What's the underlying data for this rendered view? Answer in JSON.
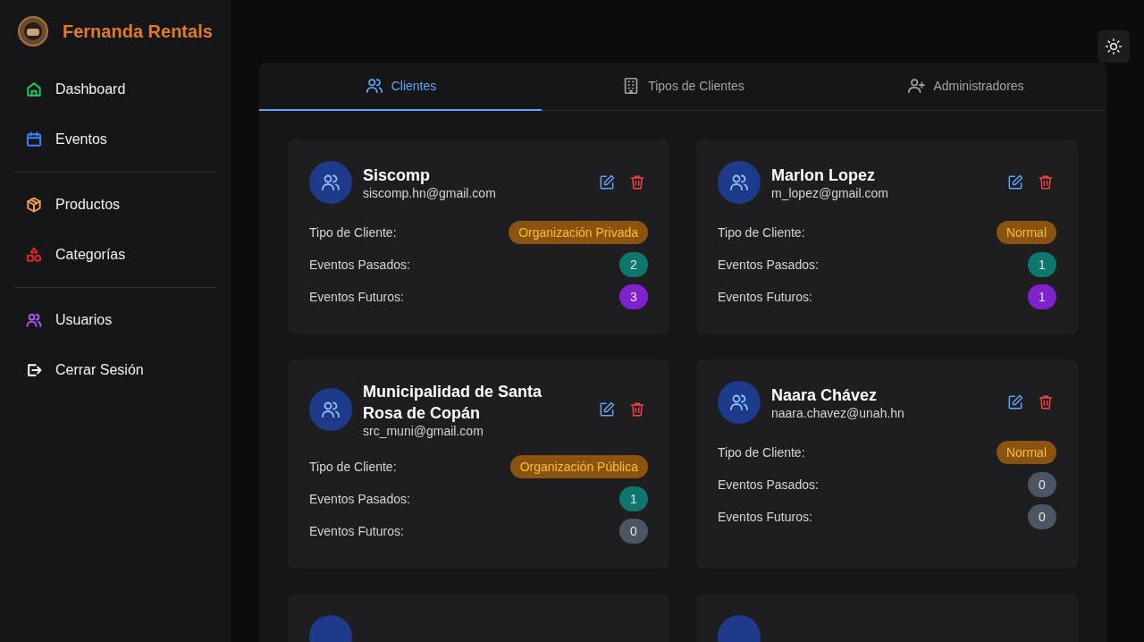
{
  "sidebar": {
    "brand": "Fernanda Rentals",
    "groups": [
      [
        {
          "label": "Dashboard",
          "color": "#22c55e"
        },
        {
          "label": "Eventos",
          "color": "#3b82f6"
        }
      ],
      [
        {
          "label": "Productos",
          "color": "#f59e5b"
        },
        {
          "label": "Categorías",
          "color": "#dc2626"
        }
      ],
      [
        {
          "label": "Usuarios",
          "color": "#a855f7"
        },
        {
          "label": "Cerrar Sesión",
          "color": "#ffffff"
        }
      ]
    ]
  },
  "tabs": [
    {
      "label": "Clientes",
      "selected": true
    },
    {
      "label": "Tipos de Clientes",
      "selected": false
    },
    {
      "label": "Administradores",
      "selected": false
    }
  ],
  "clients": [
    {
      "name": "Siscomp",
      "email": "siscomp.hn@gmail.com",
      "type_label": "Tipo de Cliente:",
      "type": "Organización Privada",
      "past_label": "Eventos Pasados:",
      "past": {
        "value": "2",
        "color": "#0f766e"
      },
      "future_label": "Eventos Futuros:",
      "future": {
        "value": "3",
        "color": "#7e22ce"
      }
    },
    {
      "name": "Marlon Lopez",
      "email": "m_lopez@gmail.com",
      "type_label": "Tipo de Cliente:",
      "type": "Normal",
      "past_label": "Eventos Pasados:",
      "past": {
        "value": "1",
        "color": "#0f766e"
      },
      "future_label": "Eventos Futuros:",
      "future": {
        "value": "1",
        "color": "#7e22ce"
      }
    },
    {
      "name": "Municipalidad de Santa Rosa de Copán",
      "email": "src_muni@gmail.com",
      "type_label": "Tipo de Cliente:",
      "type": "Organización Pública",
      "past_label": "Eventos Pasados:",
      "past": {
        "value": "1",
        "color": "#0f766e"
      },
      "future_label": "Eventos Futuros:",
      "future": {
        "value": "0",
        "color": "#4b5563"
      }
    },
    {
      "name": "Naara Chávez",
      "email": "naara.chavez@unah.hn",
      "type_label": "Tipo de Cliente:",
      "type": "Normal",
      "past_label": "Eventos Pasados:",
      "past": {
        "value": "0",
        "color": "#4b5563"
      },
      "future_label": "Eventos Futuros:",
      "future": {
        "value": "0",
        "color": "#4b5563"
      }
    },
    {
      "kind": "cut"
    },
    {
      "kind": "cut"
    }
  ]
}
